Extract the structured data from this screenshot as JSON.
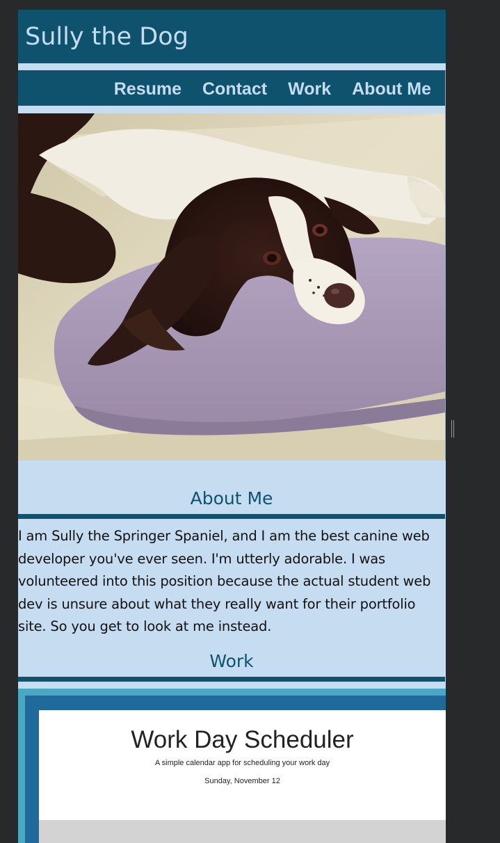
{
  "site": {
    "title": "Sully the Dog"
  },
  "nav": {
    "items": [
      {
        "label": "Resume"
      },
      {
        "label": "Contact"
      },
      {
        "label": "Work"
      },
      {
        "label": "About Me"
      }
    ]
  },
  "hero": {
    "icon": "dog-photo"
  },
  "about": {
    "heading": "About Me",
    "body": "I am Sully the Springer Spaniel, and I am the best canine web developer you've ever seen. I'm utterly adorable. I was volunteered into this position because the actual student web dev is unsure about what they really want for their portfolio site. So you get to look at me instead."
  },
  "work": {
    "heading": "Work",
    "project": {
      "title": "Work Day Scheduler",
      "subtitle": "A simple calendar app for scheduling your work day",
      "date": "Sunday, November 12"
    }
  },
  "colors": {
    "page_background": "#28292b",
    "header": "#0e526d",
    "accent_light": "#c6dcf1",
    "card_outer": "#4aa8c2",
    "card_inner": "#1f6a9a"
  }
}
